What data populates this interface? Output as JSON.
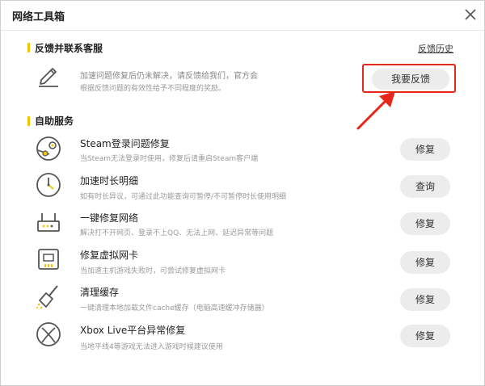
{
  "window": {
    "title": "网络工具箱"
  },
  "feedback_section": {
    "title": "反馈并联系客服",
    "history_link": "反馈历史",
    "line1": "加速问题修复后仍未解决，请反馈给我们，官方会",
    "line2": "根据反馈问题的有效性给予不同程度的奖励。",
    "button": "我要反馈",
    "icon": "pencil-icon"
  },
  "self_service": {
    "title": "自助服务",
    "items": [
      {
        "title": "Steam登录问题修复",
        "desc": "当Steam无法登录时使用，修复后请重启Steam客户端",
        "button": "修复",
        "icon": "steam-icon"
      },
      {
        "title": "加速时长明细",
        "desc": "如有时长异议，可通过此功能查询可暂停/不可暂停时长使用明细",
        "button": "查询",
        "icon": "clock-icon"
      },
      {
        "title": "一键修复网络",
        "desc": "解决打不开网页、登录不上QQ、无法上网、延迟异常等问题",
        "button": "修复",
        "icon": "router-icon"
      },
      {
        "title": "修复虚拟网卡",
        "desc": "当加速主机游戏失败时，可尝试修复虚拟网卡",
        "button": "修复",
        "icon": "network-card-icon"
      },
      {
        "title": "清理缓存",
        "desc": "一键清理本地加载文件cache缓存（电脑高速缓冲存储器）",
        "button": "修复",
        "icon": "broom-icon"
      },
      {
        "title": "Xbox Live平台异常修复",
        "desc": "当地平线4等游戏无法进入游戏时候建议使用",
        "button": "修复",
        "icon": "xbox-icon"
      }
    ]
  },
  "colors": {
    "accent": "#f5c400",
    "highlight": "#e8271c",
    "button_bg": "#ececec"
  }
}
